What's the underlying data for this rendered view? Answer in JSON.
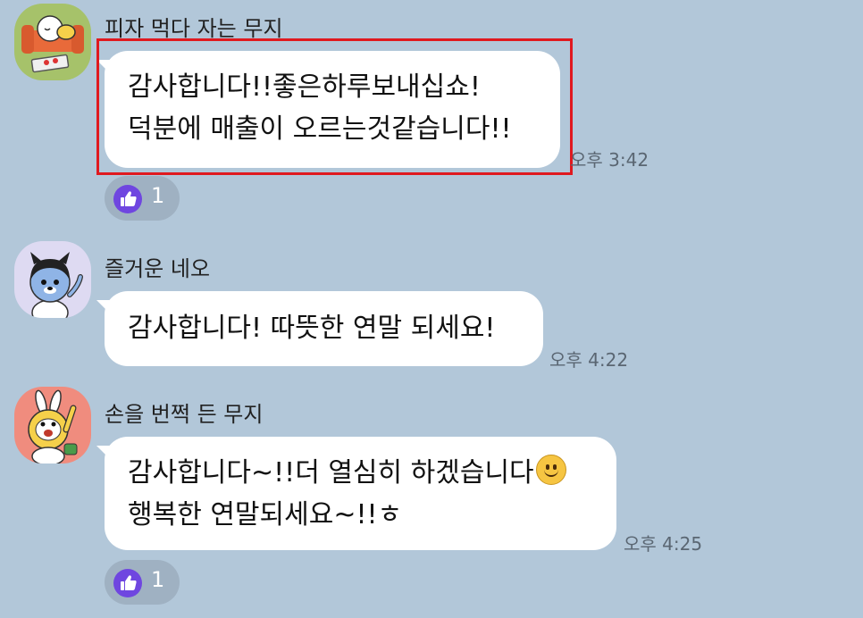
{
  "messages": [
    {
      "sender": "피자 먹다 자는 무지",
      "avatar_icon": "muzi-sleeping-on-sofa-avatar",
      "lines": [
        "감사합니다!!좋은하루보내십쇼!",
        "덕분에 매출이 오르는것같습니다!!"
      ],
      "time": "오후 3:42",
      "reaction": {
        "icon": "thumbs-up-icon",
        "count": "1"
      },
      "highlighted": true
    },
    {
      "sender": "즐거운 네오",
      "avatar_icon": "neo-waving-avatar",
      "lines": [
        "감사합니다! 따뜻한 연말 되세요!"
      ],
      "time": "오후 4:22"
    },
    {
      "sender": "손을 번쩍 든 무지",
      "avatar_icon": "muzi-raising-hand-avatar",
      "lines": [
        "감사합니다~!!더 열심히 하겠습니다",
        "행복한 연말되세요~!!ㅎ"
      ],
      "emoji": "slightly-smiling-face-emoji",
      "time": "오후 4:25",
      "reaction": {
        "icon": "thumbs-up-icon",
        "count": "1"
      }
    }
  ],
  "colors": {
    "background": "#b2c7d9",
    "bubble": "#ffffff",
    "highlight_border": "#e0191f",
    "reaction_icon": "#6f46e0",
    "reaction_pill": "#9fb1c2"
  }
}
